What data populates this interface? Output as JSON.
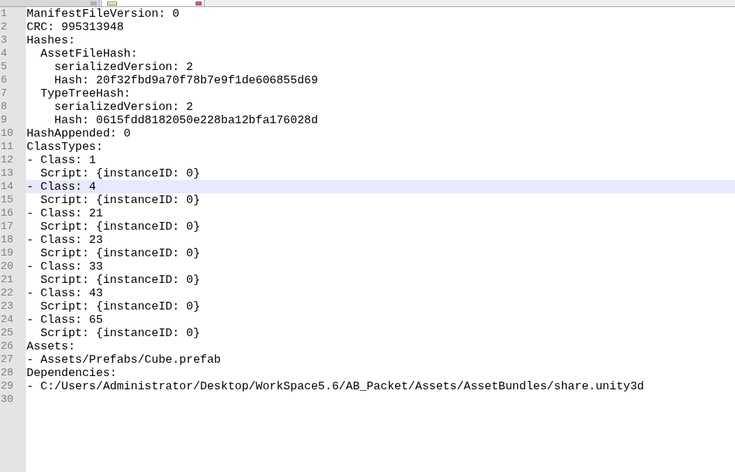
{
  "tabs": [
    {
      "selected": false,
      "modified": true
    },
    {
      "selected": true,
      "modified": true
    }
  ],
  "lines": [
    {
      "number": "1",
      "text": "ManifestFileVersion: 0",
      "current": false
    },
    {
      "number": "2",
      "text": "CRC: 995313948",
      "current": false
    },
    {
      "number": "3",
      "text": "Hashes:",
      "current": false
    },
    {
      "number": "4",
      "text": "  AssetFileHash:",
      "current": false
    },
    {
      "number": "5",
      "text": "    serializedVersion: 2",
      "current": false
    },
    {
      "number": "6",
      "text": "    Hash: 20f32fbd9a70f78b7e9f1de606855d69",
      "current": false
    },
    {
      "number": "7",
      "text": "  TypeTreeHash:",
      "current": false
    },
    {
      "number": "8",
      "text": "    serializedVersion: 2",
      "current": false
    },
    {
      "number": "9",
      "text": "    Hash: 0615fdd8182050e228ba12bfa176028d",
      "current": false
    },
    {
      "number": "10",
      "text": "HashAppended: 0",
      "current": false
    },
    {
      "number": "11",
      "text": "ClassTypes:",
      "current": false
    },
    {
      "number": "12",
      "text": "- Class: 1",
      "current": false
    },
    {
      "number": "13",
      "text": "  Script: {instanceID: 0}",
      "current": false
    },
    {
      "number": "14",
      "text": "- Class: 4",
      "current": true
    },
    {
      "number": "15",
      "text": "  Script: {instanceID: 0}",
      "current": false
    },
    {
      "number": "16",
      "text": "- Class: 21",
      "current": false
    },
    {
      "number": "17",
      "text": "  Script: {instanceID: 0}",
      "current": false
    },
    {
      "number": "18",
      "text": "- Class: 23",
      "current": false
    },
    {
      "number": "19",
      "text": "  Script: {instanceID: 0}",
      "current": false
    },
    {
      "number": "20",
      "text": "- Class: 33",
      "current": false
    },
    {
      "number": "21",
      "text": "  Script: {instanceID: 0}",
      "current": false
    },
    {
      "number": "22",
      "text": "- Class: 43",
      "current": false
    },
    {
      "number": "23",
      "text": "  Script: {instanceID: 0}",
      "current": false
    },
    {
      "number": "24",
      "text": "- Class: 65",
      "current": false
    },
    {
      "number": "25",
      "text": "  Script: {instanceID: 0}",
      "current": false
    },
    {
      "number": "26",
      "text": "Assets:",
      "current": false
    },
    {
      "number": "27",
      "text": "- Assets/Prefabs/Cube.prefab",
      "current": false
    },
    {
      "number": "28",
      "text": "Dependencies:",
      "current": false
    },
    {
      "number": "29",
      "text": "- C:/Users/Administrator/Desktop/WorkSpace5.6/AB_Packet/Assets/AssetBundles/share.unity3d",
      "current": false
    },
    {
      "number": "30",
      "current": false
    }
  ]
}
